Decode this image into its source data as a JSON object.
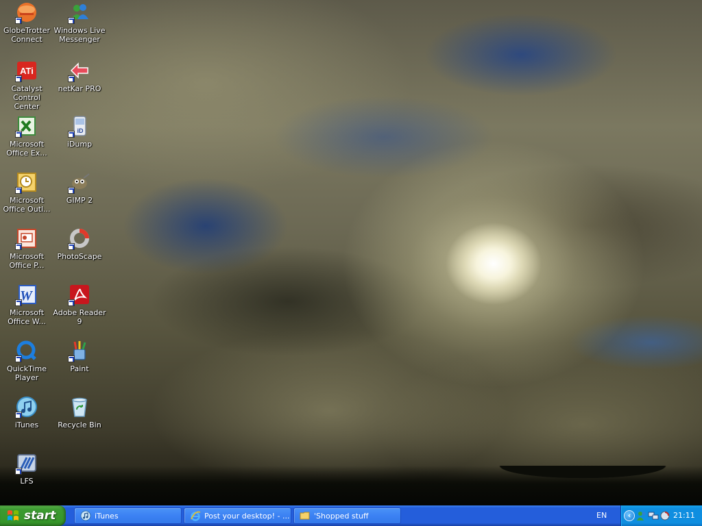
{
  "desktop": {
    "icons": [
      {
        "label": "GlobeTrotter\nConnect",
        "icon": "globetrotter-icon"
      },
      {
        "label": "Windows Live\nMessenger",
        "icon": "messenger-icon"
      },
      {
        "label": "Catalyst\nControl Center",
        "icon": "ati-icon"
      },
      {
        "label": "netKar PRO",
        "icon": "netkar-icon"
      },
      {
        "label": "Microsoft\nOffice Ex...",
        "icon": "excel-icon"
      },
      {
        "label": "iDump",
        "icon": "idump-icon"
      },
      {
        "label": "Microsoft\nOffice Outl...",
        "icon": "outlook-icon"
      },
      {
        "label": "GIMP 2",
        "icon": "gimp-icon"
      },
      {
        "label": "Microsoft\nOffice P...",
        "icon": "powerpoint-icon"
      },
      {
        "label": "PhotoScape",
        "icon": "photoscape-icon"
      },
      {
        "label": "Microsoft\nOffice W...",
        "icon": "word-icon"
      },
      {
        "label": "Adobe Reader\n9",
        "icon": "adobe-reader-icon"
      },
      {
        "label": "QuickTime\nPlayer",
        "icon": "quicktime-icon"
      },
      {
        "label": "Paint",
        "icon": "paint-icon"
      },
      {
        "label": "iTunes",
        "icon": "itunes-icon"
      },
      {
        "label": "Recycle Bin",
        "icon": "recycle-bin-icon"
      },
      {
        "label": "LFS",
        "icon": "lfs-icon"
      }
    ]
  },
  "taskbar": {
    "start_label": "start",
    "tasks": [
      {
        "label": "iTunes",
        "icon": "itunes-icon"
      },
      {
        "label": "Post your desktop! - ...",
        "icon": "internet-explorer-icon"
      },
      {
        "label": "'Shopped stuff",
        "icon": "folder-icon"
      }
    ],
    "language": "EN",
    "clock": "21:11"
  },
  "colors": {
    "taskbar_blue": "#245edb",
    "start_green": "#3c9a31",
    "tray_blue": "#0f8ee0"
  }
}
